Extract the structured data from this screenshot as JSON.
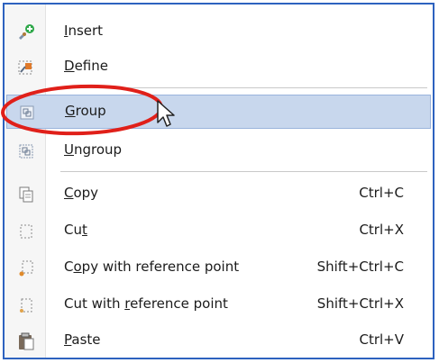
{
  "menu": {
    "items": [
      {
        "pre": "",
        "u": "I",
        "post": "nsert",
        "shortcut": "",
        "icon": "insert-block-icon"
      },
      {
        "pre": "",
        "u": "D",
        "post": "efine",
        "shortcut": "",
        "icon": "define-block-icon"
      },
      {
        "pre": "",
        "u": "G",
        "post": "roup",
        "shortcut": "",
        "icon": "group-icon"
      },
      {
        "pre": "",
        "u": "U",
        "post": "ngroup",
        "shortcut": "",
        "icon": "ungroup-icon"
      },
      {
        "pre": "",
        "u": "C",
        "post": "opy",
        "shortcut": "Ctrl+C",
        "icon": "copy-icon"
      },
      {
        "pre": "Cu",
        "u": "t",
        "post": "",
        "shortcut": "Ctrl+X",
        "icon": "cut-icon"
      },
      {
        "pre": "C",
        "u": "o",
        "post": "py with reference point",
        "shortcut": "Shift+Ctrl+C",
        "icon": "copy-with-base-point-icon"
      },
      {
        "pre": "Cut with ",
        "u": "r",
        "post": "eference point",
        "shortcut": "Shift+Ctrl+X",
        "icon": "cut-with-base-point-icon"
      },
      {
        "pre": "",
        "u": "P",
        "post": "aste",
        "shortcut": "Ctrl+V",
        "icon": "paste-icon"
      }
    ]
  },
  "colors": {
    "highlight": "#c8d7ed",
    "border": "#2d62bf",
    "annotation": "#e0201a"
  }
}
